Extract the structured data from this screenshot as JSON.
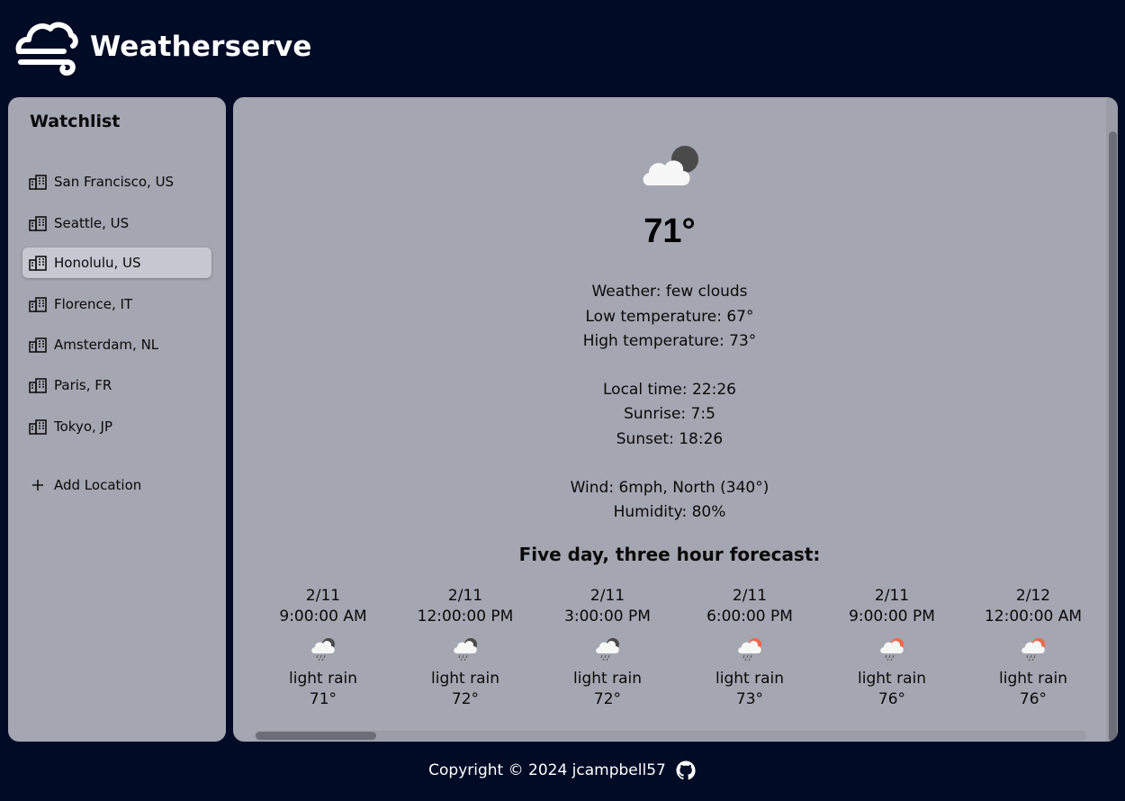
{
  "app": {
    "title": "Weatherserve"
  },
  "sidebar": {
    "title": "Watchlist",
    "items": [
      {
        "label": "San Francisco, US",
        "icon": "building-icon",
        "active": false
      },
      {
        "label": "Seattle, US",
        "icon": "building-icon",
        "active": false
      },
      {
        "label": "Honolulu, US",
        "icon": "building-icon",
        "active": true
      },
      {
        "label": "Florence, IT",
        "icon": "building-icon",
        "active": false
      },
      {
        "label": "Amsterdam, NL",
        "icon": "building-icon",
        "active": false
      },
      {
        "label": "Paris, FR",
        "icon": "building-icon",
        "active": false
      },
      {
        "label": "Tokyo, JP",
        "icon": "building-icon",
        "active": false
      }
    ],
    "add_label": "Add Location"
  },
  "current": {
    "icon": "few-clouds-night-icon",
    "temperature": "71°",
    "weather": "Weather: few clouds",
    "low": "Low temperature: 67°",
    "high": "High temperature: 73°",
    "local_time": "Local time: 22:26",
    "sunrise": "Sunrise: 7:5",
    "sunset": "Sunset: 18:26",
    "wind": "Wind: 6mph, North (340°)",
    "humidity": "Humidity: 80%"
  },
  "forecast": {
    "title": "Five day, three hour forecast:",
    "items": [
      {
        "date": "2/11",
        "time": "9:00:00 AM",
        "icon": "rain-night-icon",
        "desc": "light rain",
        "temp": "71°"
      },
      {
        "date": "2/11",
        "time": "12:00:00 PM",
        "icon": "rain-night-icon",
        "desc": "light rain",
        "temp": "72°"
      },
      {
        "date": "2/11",
        "time": "3:00:00 PM",
        "icon": "rain-night-icon",
        "desc": "light rain",
        "temp": "72°"
      },
      {
        "date": "2/11",
        "time": "6:00:00 PM",
        "icon": "rain-day-icon",
        "desc": "light rain",
        "temp": "73°"
      },
      {
        "date": "2/11",
        "time": "9:00:00 PM",
        "icon": "rain-day-icon",
        "desc": "light rain",
        "temp": "76°"
      },
      {
        "date": "2/12",
        "time": "12:00:00 AM",
        "icon": "rain-day-icon",
        "desc": "light rain",
        "temp": "76°"
      }
    ]
  },
  "footer": {
    "copyright": "Copyright © 2024 jcampbell57",
    "icon": "github-icon"
  },
  "colors": {
    "background": "#000b26",
    "panel": "#a4a6b1",
    "active_item": "#c5c8d0",
    "sun": "#f0674a",
    "moon": "#4a4a4a"
  }
}
